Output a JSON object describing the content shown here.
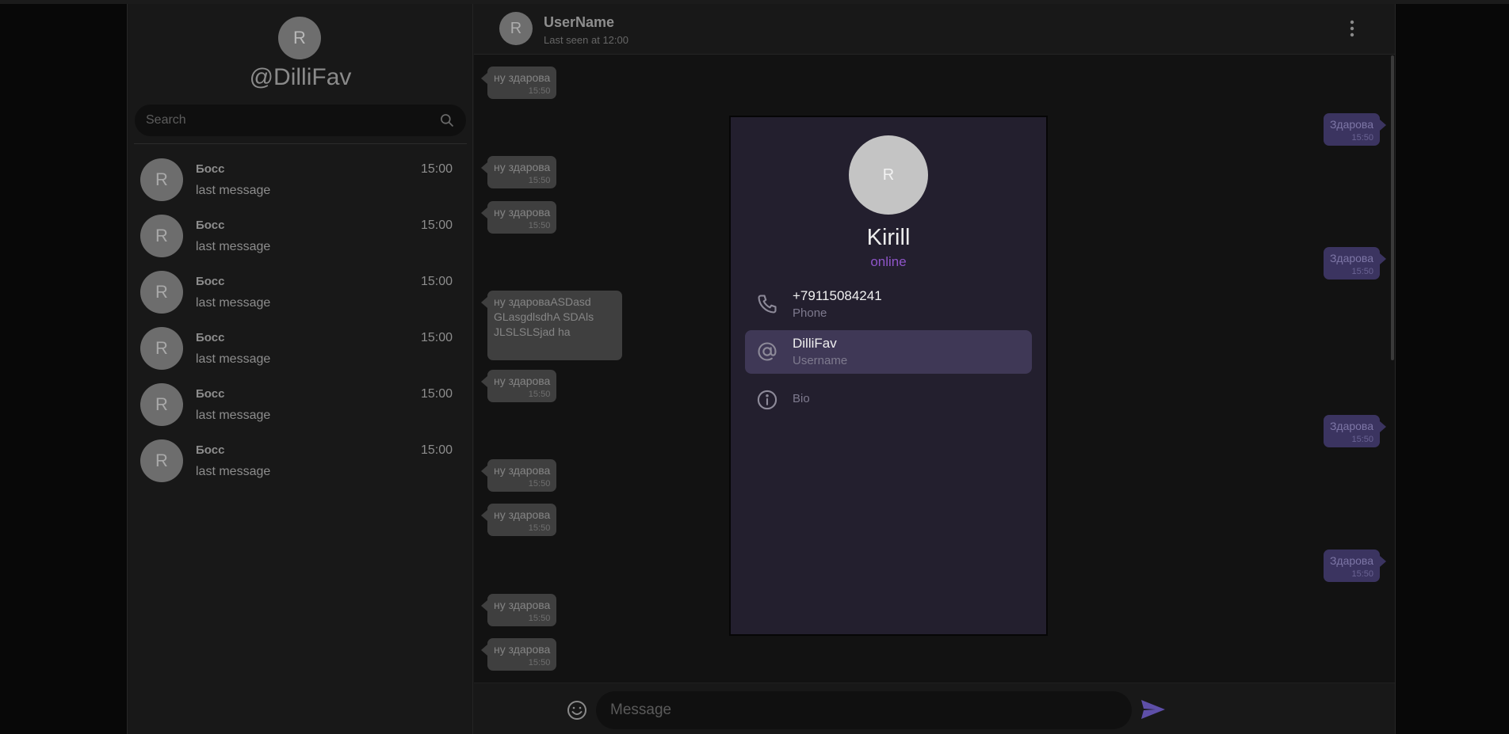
{
  "sidebar": {
    "avatar_letter": "R",
    "handle": "@DilliFav",
    "search_placeholder": "Search",
    "chats": [
      {
        "avatar": "R",
        "name": "Босс",
        "time": "15:00",
        "last": "last message"
      },
      {
        "avatar": "R",
        "name": "Босс",
        "time": "15:00",
        "last": "last message"
      },
      {
        "avatar": "R",
        "name": "Босс",
        "time": "15:00",
        "last": "last message"
      },
      {
        "avatar": "R",
        "name": "Босс",
        "time": "15:00",
        "last": "last message"
      },
      {
        "avatar": "R",
        "name": "Босс",
        "time": "15:00",
        "last": "last message"
      },
      {
        "avatar": "R",
        "name": "Босс",
        "time": "15:00",
        "last": "last message"
      }
    ]
  },
  "header": {
    "avatar_letter": "R",
    "name": "UserName",
    "status": "Last seen at 12:00"
  },
  "messages": [
    {
      "text": "ну здарова",
      "time": "15:50",
      "dir": "in"
    },
    {
      "text": "Здарова",
      "time": "15:50",
      "dir": "out"
    },
    {
      "text": "ну здарова",
      "time": "15:50",
      "dir": "in"
    },
    {
      "text": "ну здарова",
      "time": "15:50",
      "dir": "in"
    },
    {
      "text": "Здарова",
      "time": "15:50",
      "dir": "out"
    },
    {
      "text": "ну здароваASDasd",
      "text2": "GLasgdlsdhA SDAls",
      "text3": "JLSLSLSjad ha",
      "dir": "in"
    },
    {
      "text": "ну здарова",
      "time": "15:50",
      "dir": "in"
    },
    {
      "text": "Здарова",
      "time": "15:50",
      "dir": "out"
    },
    {
      "text": "ну здарова",
      "time": "15:50",
      "dir": "in"
    },
    {
      "text": "ну здарова",
      "time": "15:50",
      "dir": "in"
    },
    {
      "text": "Здарова",
      "time": "15:50",
      "dir": "out"
    },
    {
      "text": "ну здарова",
      "time": "15:50",
      "dir": "in"
    },
    {
      "text": "ну здарова",
      "time": "15:50",
      "dir": "in"
    }
  ],
  "composer": {
    "placeholder": "Message"
  },
  "profile": {
    "avatar_letter": "R",
    "name": "Kirill",
    "status": "online",
    "phone_value": "+79115084241",
    "phone_label": "Phone",
    "username_value": "DilliFav",
    "username_label": "Username",
    "bio_label": "Bio"
  },
  "icons": {
    "search": "search-icon",
    "menu": "more-vertical-icon",
    "emoji": "emoji-icon",
    "send": "send-icon",
    "phone": "phone-icon",
    "at": "at-sign-icon",
    "info": "info-icon"
  },
  "colors": {
    "accent": "#8e55c8",
    "outgoing_bubble": "#3b3460",
    "incoming_bubble": "#3f3f3f",
    "modal_bg": "#231f2e",
    "send_icon": "#5e4fa8"
  }
}
